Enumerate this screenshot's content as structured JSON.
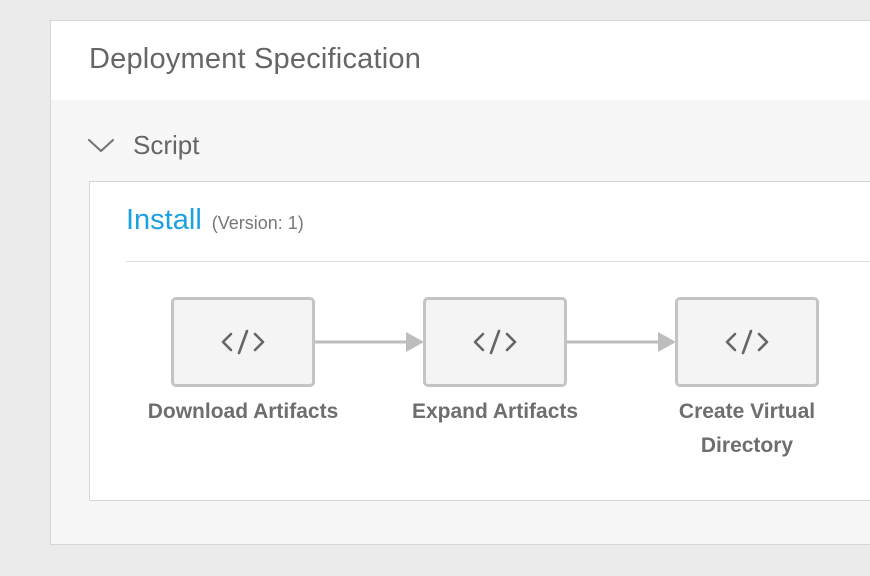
{
  "panel": {
    "title": "Deployment Specification"
  },
  "section": {
    "label": "Script",
    "expanded": true
  },
  "card": {
    "title": "Install",
    "version": "(Version: 1)"
  },
  "steps": [
    {
      "label": "Download Artifacts",
      "icon": "code-icon"
    },
    {
      "label": "Expand Artifacts",
      "icon": "code-icon"
    },
    {
      "label": "Create Virtual Directory",
      "icon": "code-icon"
    }
  ],
  "colors": {
    "accent": "#1ba1e2",
    "step_border": "#c4c4c4",
    "connector": "#bdbdbd",
    "text_muted": "#666666"
  }
}
